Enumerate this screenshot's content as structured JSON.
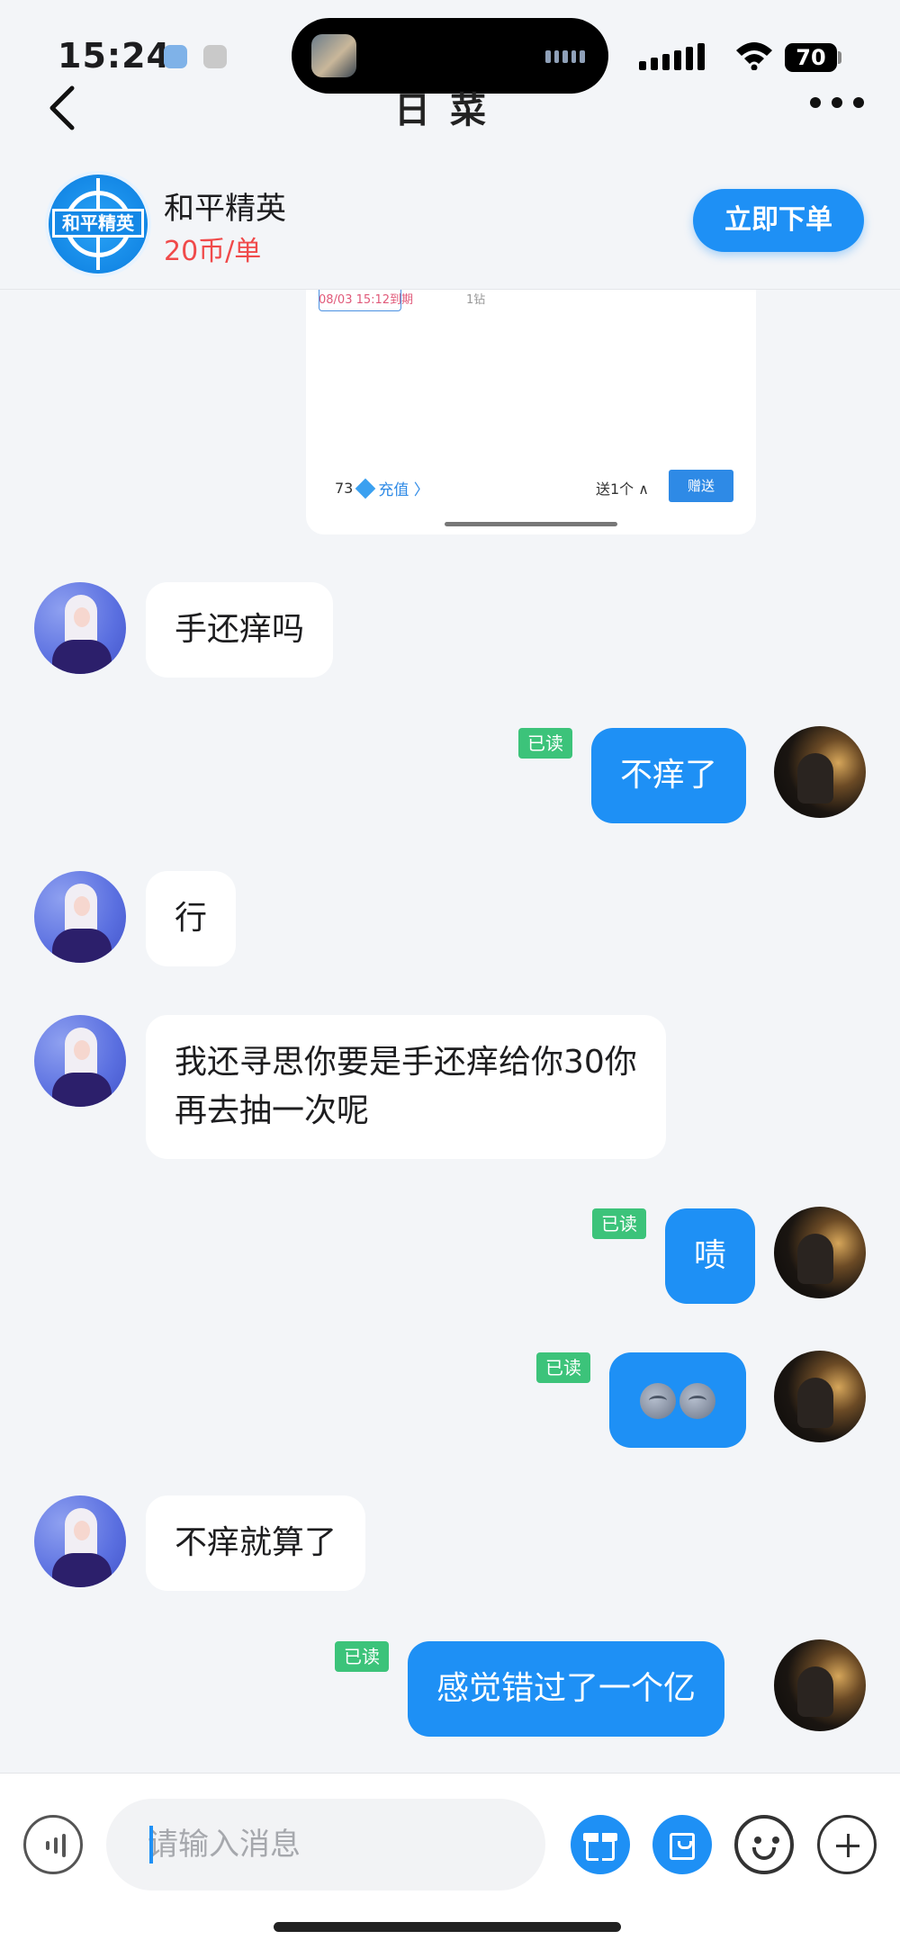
{
  "status_bar": {
    "time": "15:24",
    "battery": "70"
  },
  "header": {
    "title": "日菜"
  },
  "service": {
    "name": "和平精英",
    "price": "20币/单",
    "logo_text": "和平精英",
    "order_button": "立即下单"
  },
  "gift_screenshot": {
    "expire_text": "08/03 15:12到期",
    "item_price": "1钻",
    "balance": "73",
    "recharge": "充值 〉",
    "send_count": "送1个 ∧",
    "gift_button": "赠送"
  },
  "messages": [
    {
      "side": "in",
      "text": "手还痒吗"
    },
    {
      "side": "out",
      "text": "不痒了",
      "read": "已读"
    },
    {
      "side": "in",
      "text": "行"
    },
    {
      "side": "in",
      "text": "我还寻思你要是手还痒给你30你",
      "text2": "再去抽一次呢"
    },
    {
      "side": "out",
      "text": "啧",
      "read": "已读"
    },
    {
      "side": "out",
      "emoji": [
        "new-moon-face-emoji",
        "new-moon-face-emoji"
      ],
      "read": "已读"
    },
    {
      "side": "in",
      "text": "不痒就算了"
    },
    {
      "side": "out",
      "text": "感觉错过了一个亿",
      "read": "已读"
    }
  ],
  "input": {
    "placeholder": "请输入消息"
  },
  "colors": {
    "accent": "#1e90f5",
    "read_badge": "#3cc37a",
    "price": "#f04a4a",
    "background": "#f3f5f8"
  }
}
